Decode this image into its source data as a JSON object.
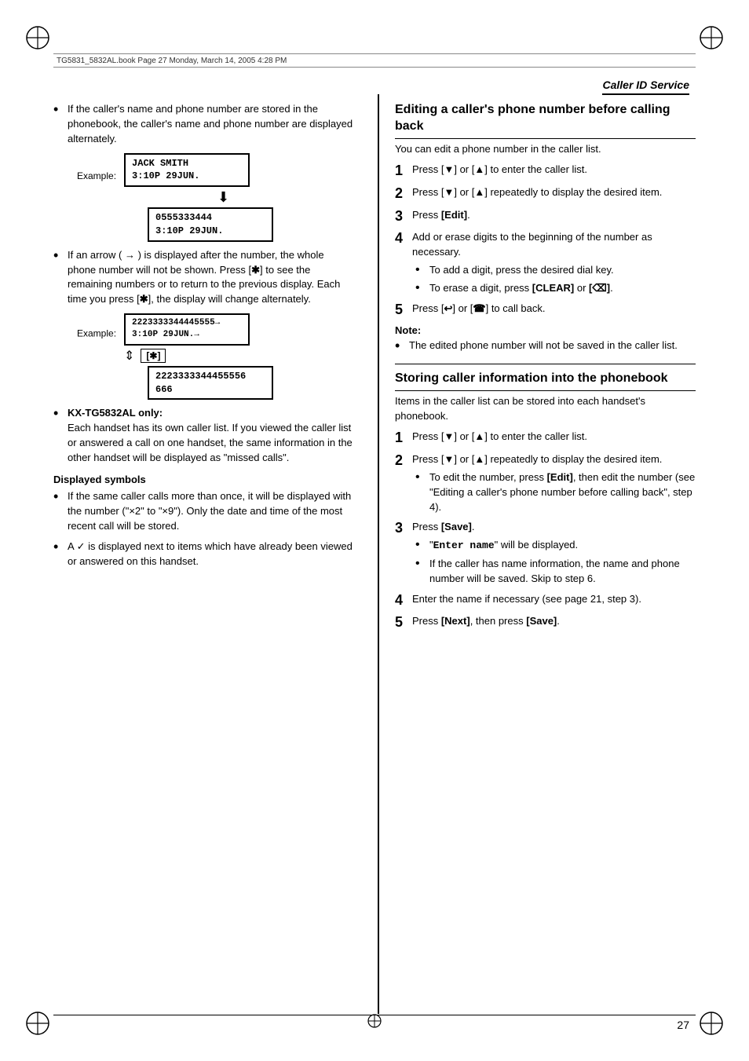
{
  "header": {
    "meta_text": "TG5831_5832AL.book  Page 27  Monday, March 14, 2005  4:28 PM",
    "page_title": "Caller ID Service"
  },
  "page_number": "27",
  "left_column": {
    "bullet1": {
      "text": "If the caller's name and phone number are stored in the phonebook, the caller's name and phone number are displayed alternately."
    },
    "example1": {
      "label": "Example:",
      "display1_line1": "JACK SMITH",
      "display1_line2": "3:10P 29JUN.",
      "display2_line1": "0555333444",
      "display2_line2": "3:10P 29JUN."
    },
    "bullet2": {
      "text_pre": "If an arrow (",
      "arrow_char": "→",
      "text_post": ") is displayed after the number, the whole phone number will not be shown. Press [",
      "star": "✱",
      "text_post2": "] to see the remaining numbers or to return to the previous display. Each time you press [",
      "star2": "✱",
      "text_post3": "], the display will change alternately."
    },
    "example2": {
      "label": "Example:",
      "display1_line1": "2223333344445555→",
      "display1_line2": "3:10P 29JUN.→",
      "star_label": "[✱]",
      "display2_line1": "2223333344455556",
      "display2_line2": "666"
    },
    "bullet3": {
      "title": "KX-TG5832AL only:",
      "text": "Each handset has its own caller list. If you viewed the caller list or answered a call on one handset, the same information in the other handset will be displayed as \"missed calls\"."
    },
    "subsection": {
      "heading": "Displayed symbols",
      "bullet1": "If the same caller calls more than once, it will be displayed with the number (\"×2\" to \"×9\"). Only the date and time of the most recent call will be stored.",
      "bullet2": "A ✓ is displayed next to items which have already been viewed or answered on this handset."
    }
  },
  "right_column": {
    "section1": {
      "heading": "Editing a caller's phone number before calling back",
      "intro": "You can edit a phone number in the caller list.",
      "steps": [
        {
          "num": "1",
          "text": "Press [▼] or [▲] to enter the caller list."
        },
        {
          "num": "2",
          "text": "Press [▼] or [▲] repeatedly to display the desired item."
        },
        {
          "num": "3",
          "text": "Press [Edit]."
        },
        {
          "num": "4",
          "text": "Add or erase digits to the beginning of the number as necessary.",
          "sub_bullets": [
            "To add a digit, press the desired dial key.",
            "To erase a digit, press [CLEAR] or [⌫]."
          ]
        },
        {
          "num": "5",
          "text": "Press [↩] or [☎] to call back."
        }
      ],
      "note_label": "Note:",
      "note_text": "The edited phone number will not be saved in the caller list."
    },
    "section2": {
      "heading": "Storing caller information into the phonebook",
      "intro": "Items in the caller list can be stored into each handset's phonebook.",
      "steps": [
        {
          "num": "1",
          "text": "Press [▼] or [▲] to enter the caller list."
        },
        {
          "num": "2",
          "text": "Press [▼] or [▲] repeatedly to display the desired item.",
          "sub_bullets": [
            "To edit the number, press [Edit], then edit the number (see \"Editing a caller's phone number before calling back\", step 4)."
          ]
        },
        {
          "num": "3",
          "text": "Press [Save].",
          "sub_bullets": [
            "\"Enter name\" will be displayed.",
            "If the caller has name information, the name and phone number will be saved. Skip to step 6."
          ]
        },
        {
          "num": "4",
          "text": "Enter the name if necessary (see page 21, step 3)."
        },
        {
          "num": "5",
          "text": "Press [Next], then press [Save]."
        }
      ]
    }
  }
}
